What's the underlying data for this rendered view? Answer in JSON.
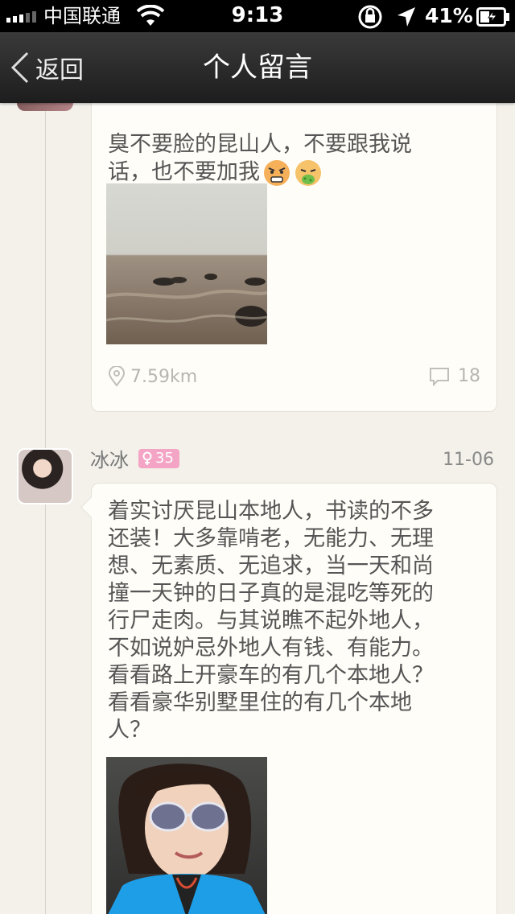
{
  "status_bar": {
    "carrier": "中国联通",
    "time": "9:13",
    "battery_percent": "41%",
    "battery_level": 0.41
  },
  "nav": {
    "back_label": "返回",
    "title": "个人留言"
  },
  "posts": [
    {
      "text": "臭不要脸的昆山人，不要跟我说\n话，也不要加我",
      "emojis": [
        "angry-emoji",
        "sick-emoji"
      ],
      "distance": "7.59km",
      "comments": "18"
    },
    {
      "username": "冰冰",
      "age": "35",
      "date": "11-06",
      "text": "着实讨厌昆山本地人，书读的不多\n还装！大多靠啃老，无能力、无理\n想、无素质、无追求，当一天和尚\n撞一天钟的日子真的是混吃等死的\n行尸走肉。与其说瞧不起外地人，\n不如说妒忌外地人有钱、有能力。\n看看路上开豪车的有几个本地人？\n看看豪华别墅里住的有几个本地\n人？"
    }
  ],
  "icons": {
    "signal": "signal-bars-icon",
    "wifi": "wifi-icon",
    "rotation_lock": "rotation-lock-icon",
    "location": "location-arrow-icon",
    "battery": "battery-icon",
    "back": "chevron-left-icon",
    "pin": "location-pin-icon",
    "comment": "comment-bubble-icon",
    "gender": "female-icon"
  },
  "colors": {
    "background": "#f3f1ea",
    "nav_bar": "#262626",
    "card": "#fefdf8",
    "badge": "#f4a4c4",
    "text": "#555555"
  }
}
